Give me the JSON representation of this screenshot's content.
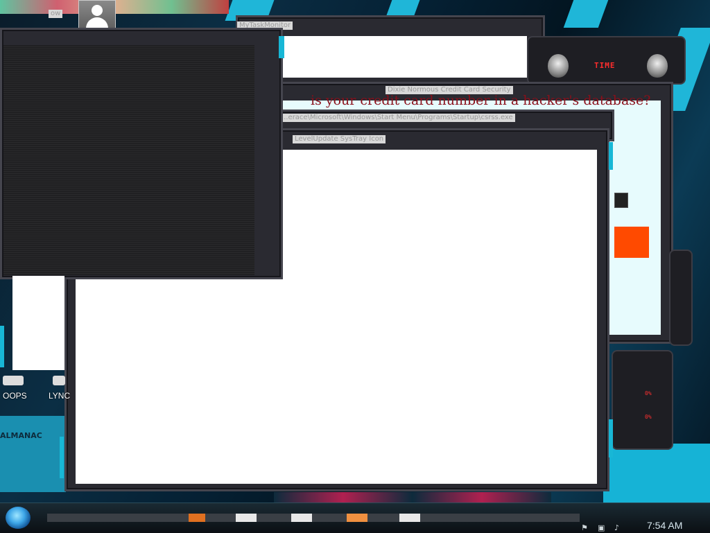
{
  "windows": {
    "w_top_title": "MyTaskMonitor",
    "w_credit_title": "Dixie Normous Credit Card Security",
    "w_credit_headline": "is your credit card number in a hacker's database?",
    "w_path_title": "...erace\\Microsoft\\Windows\\Start Menu\\Programs\\Startup\\csrss.exe",
    "w_front_title": "LevelUpdate SysTray Icon",
    "w_left_title": "ow"
  },
  "desktop": {
    "icon_oops": "OOPS",
    "icon_lync": "LYNC",
    "brand": "ALMANAC"
  },
  "gadget": {
    "time_logo": "TIME",
    "pct_a": "0%",
    "pct_b": "0%"
  },
  "taskbar": {
    "clock": "7:54 AM"
  },
  "colors": {
    "accent_cyan": "#18b7d6",
    "alert_orange": "#ff4a00",
    "alien_red": "#ff2d2d"
  },
  "icons": [
    "user-avatar-icon",
    "start-orb-icon",
    "network-icon",
    "volume-icon",
    "flag-icon",
    "alien-head-icon"
  ]
}
